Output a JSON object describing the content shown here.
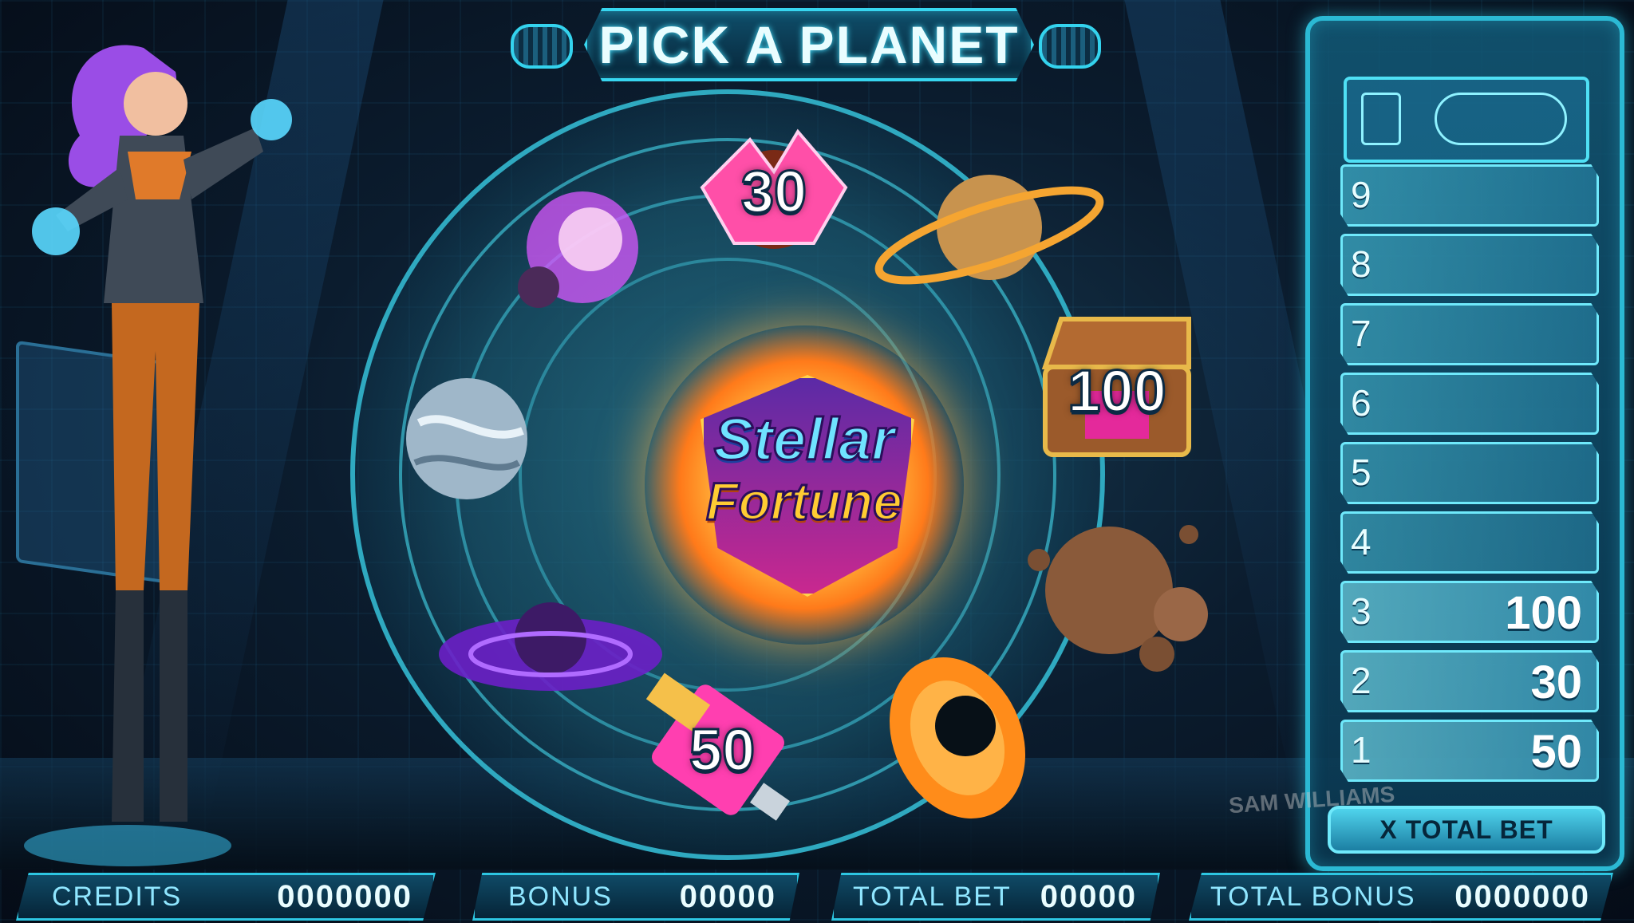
{
  "title": "PICK A PLANET",
  "logo": {
    "line1": "Stellar",
    "line2": "Fortune"
  },
  "picks": [
    {
      "name": "crystal-planet",
      "value": "30"
    },
    {
      "name": "ringed-planet",
      "value": ""
    },
    {
      "name": "treasure-chest",
      "value": "100"
    },
    {
      "name": "moon-cluster",
      "value": ""
    },
    {
      "name": "black-hole",
      "value": ""
    },
    {
      "name": "usb-drive",
      "value": "50"
    },
    {
      "name": "purple-ringed-planet",
      "value": ""
    },
    {
      "name": "ice-planet",
      "value": ""
    },
    {
      "name": "pink-comet",
      "value": ""
    }
  ],
  "ladder": {
    "rungs": [
      {
        "level": "9",
        "value": ""
      },
      {
        "level": "8",
        "value": ""
      },
      {
        "level": "7",
        "value": ""
      },
      {
        "level": "6",
        "value": ""
      },
      {
        "level": "5",
        "value": ""
      },
      {
        "level": "4",
        "value": ""
      },
      {
        "level": "3",
        "value": "100"
      },
      {
        "level": "2",
        "value": "30"
      },
      {
        "level": "1",
        "value": "50"
      }
    ],
    "footer": "X TOTAL BET"
  },
  "meters": {
    "credits": {
      "label": "CREDITS",
      "value": "0000000"
    },
    "bonus": {
      "label": "BONUS",
      "value": "00000"
    },
    "total_bet": {
      "label": "TOTAL BET",
      "value": "00000"
    },
    "total_bonus": {
      "label": "TOTAL BONUS",
      "value": "0000000"
    }
  },
  "signature": "SAM WILLIAMS",
  "colors": {
    "accent": "#2dc6e2",
    "panel": "#0f4a66",
    "logo_gold": "#ffcc33",
    "logo_cyan": "#6fe3ff"
  }
}
